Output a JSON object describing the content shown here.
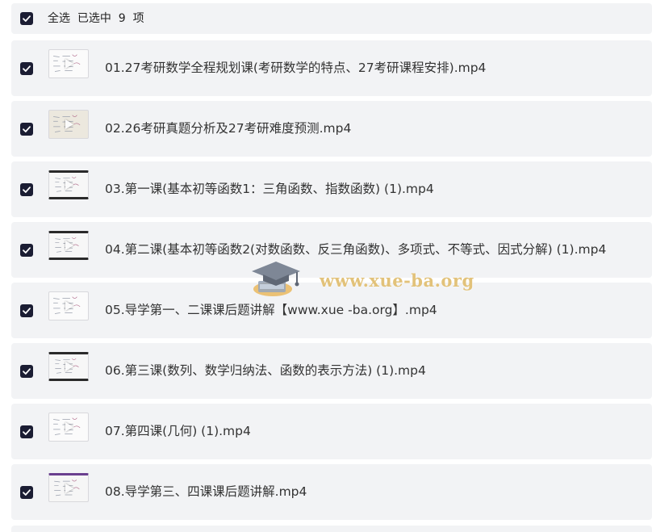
{
  "header": {
    "select_all_label": "全选",
    "selected_text": "已选中  9  项"
  },
  "files": [
    {
      "title": "01.27考研数学全程规划课(考研数学的特点、27考研课程安排).mp4",
      "checked": true,
      "thumb": "white"
    },
    {
      "title": "02.26考研真题分析及27考研难度预测.mp4",
      "checked": true,
      "thumb": "beige"
    },
    {
      "title": "03.第一课(基本初等函数1：三角函数、指数函数) (1).mp4",
      "checked": true,
      "thumb": "dark"
    },
    {
      "title": "04.第二课(基本初等函数2(对数函数、反三角函数)、多项式、不等式、因式分解) (1).mp4",
      "checked": true,
      "thumb": "dark"
    },
    {
      "title": "05.导学第一、二课课后题讲解【www.xue -ba.org】.mp4",
      "checked": true,
      "thumb": "white"
    },
    {
      "title": "06.第三课(数列、数学归纳法、函数的表示方法) (1).mp4",
      "checked": true,
      "thumb": "dark"
    },
    {
      "title": "07.第四课(几何) (1).mp4",
      "checked": true,
      "thumb": "white"
    },
    {
      "title": "08.导学第三、四课课后题讲解.mp4",
      "checked": true,
      "thumb": "purple"
    }
  ],
  "watermark": {
    "text": "www.xue-ba.org",
    "icon": "graduation-cap-icon"
  },
  "colors": {
    "checkbox_fill": "#1b1d33",
    "row_background": "#f2f3f5",
    "watermark_text": "#e2c27a"
  }
}
